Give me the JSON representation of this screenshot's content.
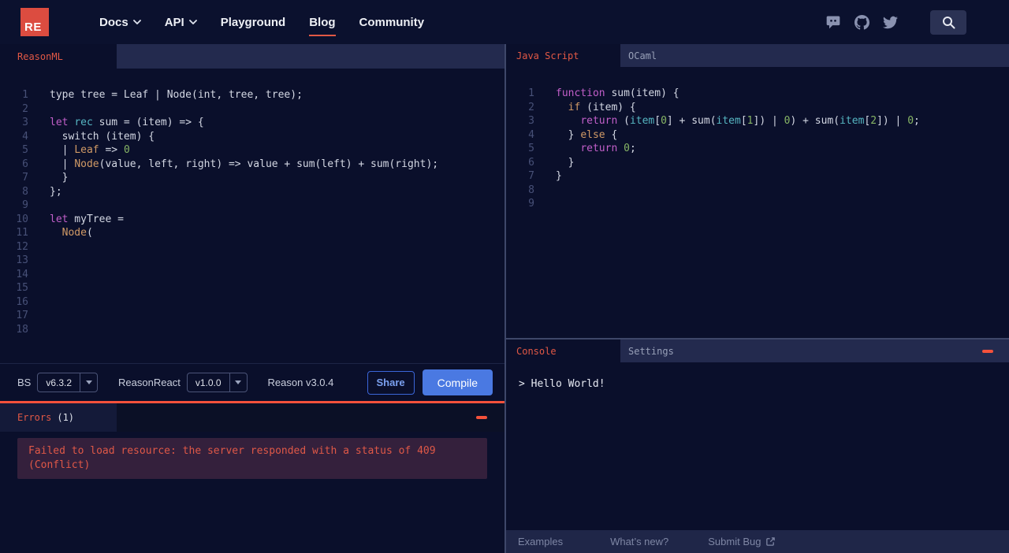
{
  "navbar": {
    "logo_text": "RE",
    "items": [
      {
        "label": "Docs",
        "has_dropdown": true
      },
      {
        "label": "API",
        "has_dropdown": true
      },
      {
        "label": "Playground"
      },
      {
        "label": "Blog",
        "active": true
      },
      {
        "label": "Community"
      }
    ],
    "icons": [
      "discord-icon",
      "github-icon",
      "twitter-icon",
      "search-icon"
    ]
  },
  "left": {
    "tab_label": "ReasonML",
    "editor": {
      "lines": [
        [
          {
            "t": "type tree = Leaf | Node(int, tree, tree);",
            "c": "d"
          }
        ],
        [],
        [
          {
            "t": "let",
            "c": "k"
          },
          {
            "t": " ",
            "c": "d"
          },
          {
            "t": "rec",
            "c": "c"
          },
          {
            "t": " sum = (item) => {",
            "c": "d"
          }
        ],
        [
          {
            "t": "  switch (item) {",
            "c": "d"
          }
        ],
        [
          {
            "t": "  | ",
            "c": "d"
          },
          {
            "t": "Leaf",
            "c": "o"
          },
          {
            "t": " => ",
            "c": "d"
          },
          {
            "t": "0",
            "c": "n"
          }
        ],
        [
          {
            "t": "  | ",
            "c": "d"
          },
          {
            "t": "Node",
            "c": "o"
          },
          {
            "t": "(value, left, right) => value + sum(left) + sum(right);",
            "c": "d"
          }
        ],
        [
          {
            "t": "  }",
            "c": "d"
          }
        ],
        [
          {
            "t": "};",
            "c": "d"
          }
        ],
        [],
        [
          {
            "t": "let",
            "c": "k"
          },
          {
            "t": " myTree =",
            "c": "d"
          }
        ],
        [
          {
            "t": "  ",
            "c": "d"
          },
          {
            "t": "Node",
            "c": "o"
          },
          {
            "t": "(",
            "c": "d"
          }
        ],
        [],
        [],
        [],
        [],
        [],
        [],
        []
      ]
    },
    "toolbar": {
      "bs_label": "BS",
      "bs_version": "v6.3.2",
      "reasonreact_label": "ReasonReact",
      "reasonreact_version": "v1.0.0",
      "reason_version": "Reason v3.0.4",
      "share_label": "Share",
      "compile_label": "Compile"
    },
    "errors": {
      "title": "Errors",
      "count": "(1)",
      "message": "Failed to load resource: the server responded with a status of 409 (Conflict)"
    }
  },
  "right": {
    "tabs": [
      {
        "label": "Java Script",
        "active": true
      },
      {
        "label": "OCaml"
      }
    ],
    "editor": {
      "lines": [
        [
          {
            "t": "function",
            "c": "k"
          },
          {
            "t": " sum(item) {",
            "c": "d"
          }
        ],
        [
          {
            "t": "  ",
            "c": "d"
          },
          {
            "t": "if",
            "c": "o"
          },
          {
            "t": " (item) {",
            "c": "d"
          }
        ],
        [
          {
            "t": "    ",
            "c": "d"
          },
          {
            "t": "return",
            "c": "k"
          },
          {
            "t": " (",
            "c": "d"
          },
          {
            "t": "item",
            "c": "c"
          },
          {
            "t": "[",
            "c": "d"
          },
          {
            "t": "0",
            "c": "n"
          },
          {
            "t": "] + sum(",
            "c": "d"
          },
          {
            "t": "item",
            "c": "c"
          },
          {
            "t": "[",
            "c": "d"
          },
          {
            "t": "1",
            "c": "n"
          },
          {
            "t": "]) | ",
            "c": "d"
          },
          {
            "t": "0",
            "c": "n"
          },
          {
            "t": ") + sum(",
            "c": "d"
          },
          {
            "t": "item",
            "c": "c"
          },
          {
            "t": "[",
            "c": "d"
          },
          {
            "t": "2",
            "c": "n"
          },
          {
            "t": "]) | ",
            "c": "d"
          },
          {
            "t": "0",
            "c": "n"
          },
          {
            "t": ";",
            "c": "d"
          }
        ],
        [
          {
            "t": "  } ",
            "c": "d"
          },
          {
            "t": "else",
            "c": "o"
          },
          {
            "t": " {",
            "c": "d"
          }
        ],
        [
          {
            "t": "    ",
            "c": "d"
          },
          {
            "t": "return",
            "c": "k"
          },
          {
            "t": " ",
            "c": "d"
          },
          {
            "t": "0",
            "c": "n"
          },
          {
            "t": ";",
            "c": "d"
          }
        ],
        [
          {
            "t": "  }",
            "c": "d"
          }
        ],
        [
          {
            "t": "}",
            "c": "d"
          }
        ],
        [],
        []
      ]
    },
    "console": {
      "tabs": [
        {
          "label": "Console",
          "active": true
        },
        {
          "label": "Settings"
        }
      ],
      "output": "> Hello World!"
    },
    "footer": {
      "links": [
        "Examples",
        "What’s new?",
        "Submit Bug"
      ]
    }
  },
  "colors": {
    "bg": "#0a0f2b",
    "navbar-bg": "#0b112e",
    "strip-bg": "#232a4e",
    "tab-active-bg": "#0a0f2b",
    "accent-red": "#e25845",
    "bright-red": "#f4513b",
    "logo-red": "#dc4c40",
    "compile-blue": "#4a79e2",
    "share-blue": "#7ba1f0",
    "errors-tab-bg": "#141a39",
    "error-box-bg": "#34203c",
    "error-text": "#df5847",
    "divider": "#3e4769",
    "footer-bg": "#1f2648",
    "muted-text": "#98a0b8",
    "line-number": "#475077",
    "code-default": "#d3d7e3",
    "code-keyword": "#c25fc9",
    "code-cyan": "#56b6c2",
    "code-orange": "#d19a66",
    "code-number": "#87b565"
  }
}
